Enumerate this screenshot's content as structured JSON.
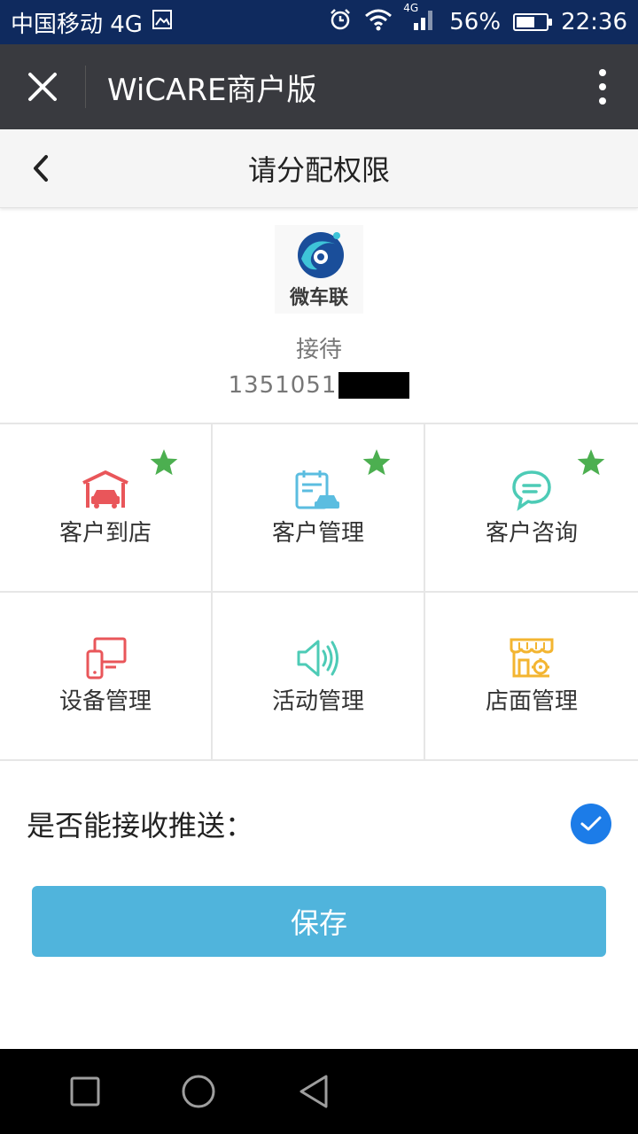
{
  "status_bar": {
    "carrier": "中国移动 4G",
    "battery": "56%",
    "time": "22:36",
    "signal_label": "4G",
    "icons": [
      "image-icon",
      "alarm-icon",
      "wifi-icon",
      "signal-icon",
      "battery-icon"
    ]
  },
  "app_header": {
    "title": "WiCARE商户版",
    "close_icon": "close-icon",
    "more_icon": "more-vertical-icon"
  },
  "nav": {
    "title": "请分配权限",
    "back_icon": "chevron-left-icon"
  },
  "profile": {
    "logo_text": "微车联",
    "role": "接待",
    "phone": "1351051"
  },
  "permissions": [
    {
      "label": "客户到店",
      "icon": "garage-car-icon",
      "color": "#e9565a",
      "starred": true
    },
    {
      "label": "客户管理",
      "icon": "calendar-car-icon",
      "color": "#5bbde0",
      "starred": true
    },
    {
      "label": "客户咨询",
      "icon": "chat-bubble-icon",
      "color": "#4dcbb6",
      "starred": true
    },
    {
      "label": "设备管理",
      "icon": "devices-icon",
      "color": "#e9565a",
      "starred": false
    },
    {
      "label": "活动管理",
      "icon": "speaker-icon",
      "color": "#4dcbb6",
      "starred": false
    },
    {
      "label": "店面管理",
      "icon": "storefront-gear-icon",
      "color": "#f3b531",
      "starred": false
    }
  ],
  "star_color": "#4caf50",
  "push": {
    "label": "是否能接收推送：",
    "checked": true
  },
  "save_label": "保存",
  "colors": {
    "status_bar_bg": "#0f2a5e",
    "header_bg": "#393a3f",
    "check_blue": "#1c7ce8",
    "save_bg": "#50b4dc"
  }
}
